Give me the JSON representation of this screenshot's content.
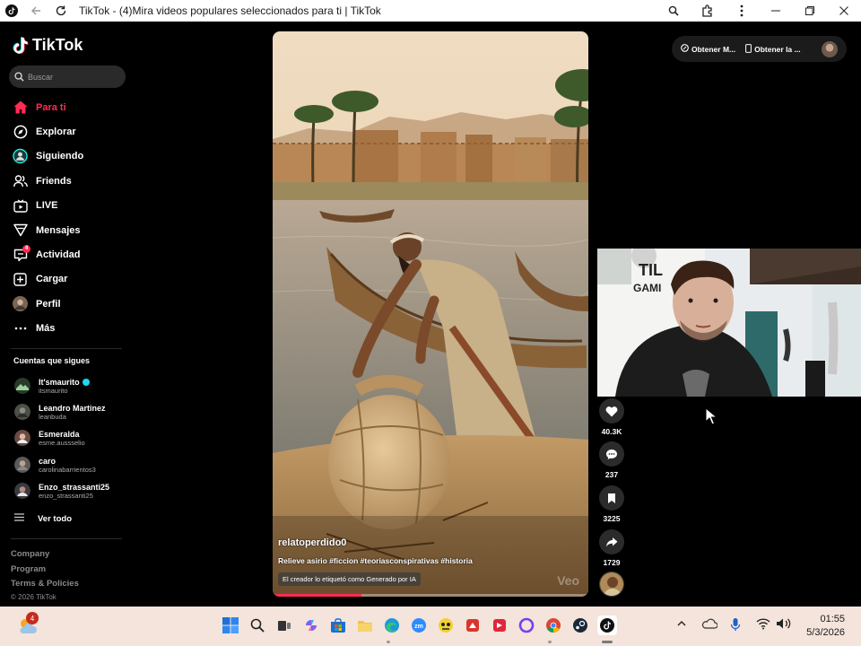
{
  "window": {
    "title": "TikTok - (4)Mira videos populares seleccionados para ti | TikTok"
  },
  "sidebar": {
    "logo": "TikTok",
    "search_placeholder": "Buscar",
    "nav": [
      {
        "label": "Para ti",
        "icon": "home-icon",
        "active": true
      },
      {
        "label": "Explorar",
        "icon": "compass-icon"
      },
      {
        "label": "Siguiendo",
        "icon": "following-icon"
      },
      {
        "label": "Friends",
        "icon": "friends-icon"
      },
      {
        "label": "LIVE",
        "icon": "live-icon"
      },
      {
        "label": "Mensajes",
        "icon": "messages-icon"
      },
      {
        "label": "Actividad",
        "icon": "activity-icon",
        "badge": "4"
      },
      {
        "label": "Cargar",
        "icon": "upload-icon"
      },
      {
        "label": "Perfil",
        "icon": "profile-avatar"
      },
      {
        "label": "Más",
        "icon": "more-icon"
      }
    ],
    "following_title": "Cuentas que sigues",
    "accounts": [
      {
        "name": "It'smaurito",
        "username": "itsmaurito",
        "verified": true
      },
      {
        "name": "Leandro Martinez",
        "username": "leanbuda"
      },
      {
        "name": "Esmeralda",
        "username": "esme.aussselio"
      },
      {
        "name": "caro",
        "username": "carolinabarrientos3"
      },
      {
        "name": "Enzo_strassanti25",
        "username": "enzo_strassanti25"
      }
    ],
    "see_all": "Ver todo",
    "footer_links": [
      "Company",
      "Program",
      "Terms & Policies"
    ],
    "copyright": "© 2026 TikTok"
  },
  "top_actions": {
    "btn1": "Obtener M...",
    "btn2": "Obtener la ..."
  },
  "video": {
    "username": "relatoperdido0",
    "description": "Relieve asirio #ficcion #teoriasconspirativas #historia",
    "ai_label": "El creador lo etiquetó como Generado por IA",
    "watermark": "Veo",
    "progress": 0.28
  },
  "actions": {
    "likes": "40.3K",
    "comments": "237",
    "saves": "3225",
    "shares": "1729"
  },
  "taskbar": {
    "weather_badge": "4",
    "time": "01:55",
    "date": "5/3/2026"
  },
  "colors": {
    "accent": "#fe2c55",
    "verified": "#20d5ec",
    "taskbar": "#f4e4dc"
  }
}
